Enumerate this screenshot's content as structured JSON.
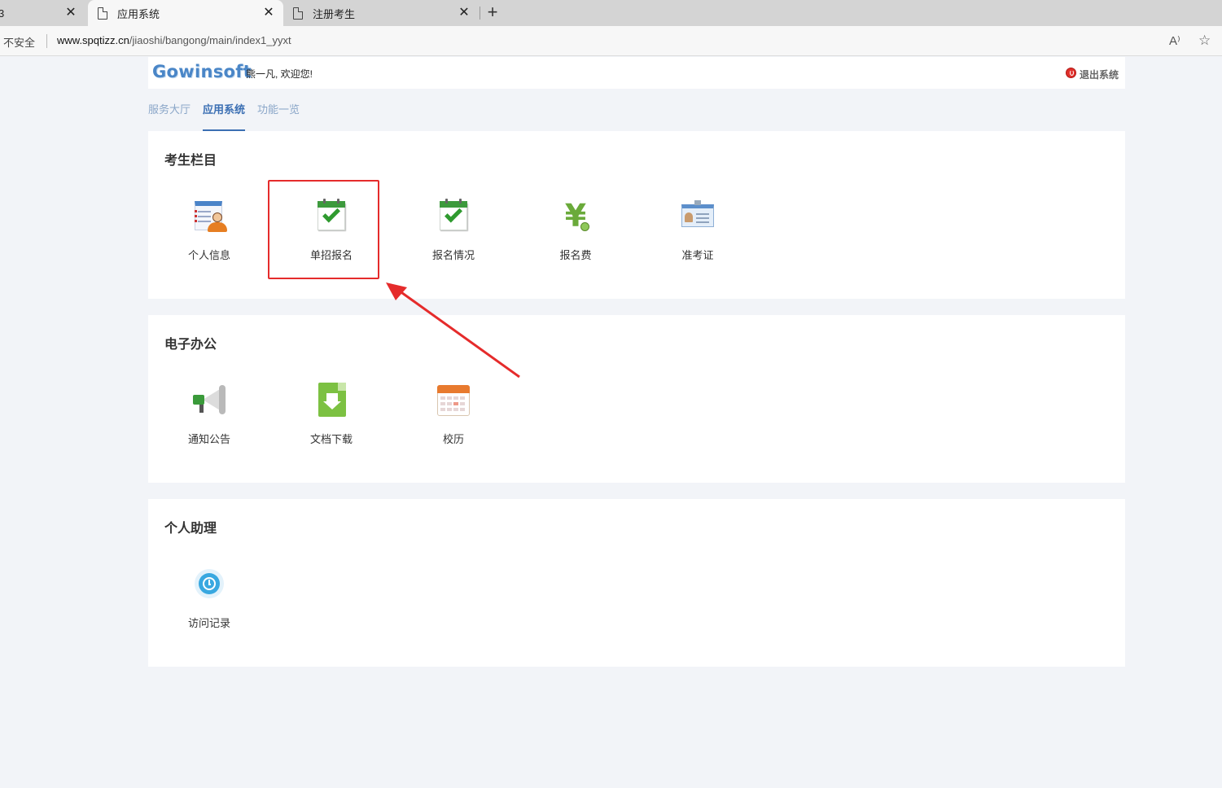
{
  "browser": {
    "tabs": [
      {
        "title": "",
        "close": "✕",
        "active": false
      },
      {
        "title": "应用系统",
        "close": "✕",
        "active": true
      },
      {
        "title": "注册考生",
        "close": "✕",
        "active": false
      }
    ],
    "new_tab": "+",
    "security_label": "不安全",
    "url_host": "www.spqtizz.cn",
    "url_path": "/jiaoshi/bangong/main/index1_yyxt",
    "read_aloud_glyph": "A⁾",
    "favorites_glyph": "☆"
  },
  "header": {
    "logo": "Gowinsoft",
    "welcome": "熊一凡, 欢迎您!",
    "logout": "退出系统"
  },
  "nav": {
    "tabs": [
      {
        "label": "服务大厅",
        "active": false
      },
      {
        "label": "应用系统",
        "active": true
      },
      {
        "label": "功能一览",
        "active": false
      }
    ]
  },
  "sections": [
    {
      "title": "考生栏目",
      "items": [
        {
          "label": "个人信息",
          "icon": "profile-icon"
        },
        {
          "label": "单招报名",
          "icon": "calendar-check-icon"
        },
        {
          "label": "报名情况",
          "icon": "calendar-check-icon"
        },
        {
          "label": "报名费",
          "icon": "yen-icon"
        },
        {
          "label": "准考证",
          "icon": "id-card-icon"
        }
      ]
    },
    {
      "title": "电子办公",
      "items": [
        {
          "label": "通知公告",
          "icon": "megaphone-icon"
        },
        {
          "label": "文档下载",
          "icon": "download-doc-icon"
        },
        {
          "label": "校历",
          "icon": "school-calendar-icon"
        }
      ]
    },
    {
      "title": "个人助理",
      "items": [
        {
          "label": "访问记录",
          "icon": "history-clock-icon"
        }
      ]
    }
  ],
  "colors": {
    "highlight": "#e52b2b",
    "nav_active": "#3b6fb3",
    "logo": "#4a86c7"
  }
}
